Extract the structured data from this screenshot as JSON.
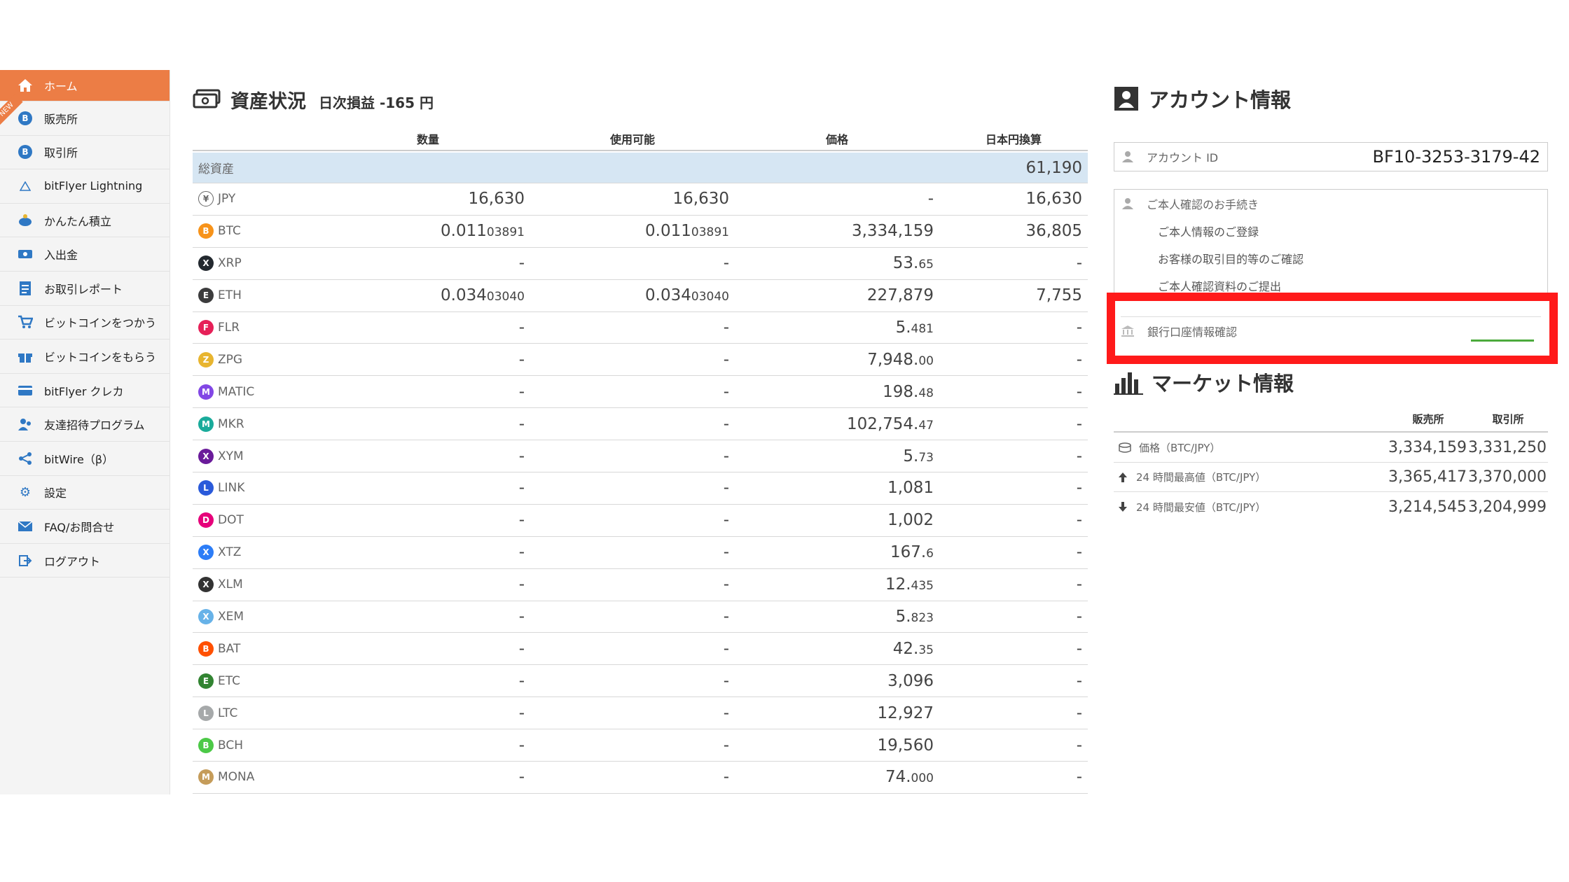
{
  "sidebar": {
    "new_badge": "NEW",
    "items": [
      {
        "label": "ホーム",
        "icon": "home-icon"
      },
      {
        "label": "販売所",
        "icon": "bitcoin-circle-icon"
      },
      {
        "label": "取引所",
        "icon": "bitcoin-circle-icon"
      },
      {
        "label": "bitFlyer Lightning",
        "icon": "lightning-triangle-icon"
      },
      {
        "label": "かんたん積立",
        "icon": "piggy-bank-icon"
      },
      {
        "label": "入出金",
        "icon": "money-icon"
      },
      {
        "label": "お取引レポート",
        "icon": "report-icon"
      },
      {
        "label": "ビットコインをつかう",
        "icon": "cart-icon"
      },
      {
        "label": "ビットコインをもらう",
        "icon": "gift-icon"
      },
      {
        "label": "bitFlyer クレカ",
        "icon": "credit-card-icon"
      },
      {
        "label": "友達招待プログラム",
        "icon": "users-icon"
      },
      {
        "label": "bitWire（β）",
        "icon": "share-icon"
      },
      {
        "label": "設定",
        "icon": "gear-icon"
      },
      {
        "label": "FAQ/お問合せ",
        "icon": "mail-icon"
      },
      {
        "label": "ログアウト",
        "icon": "logout-icon"
      }
    ]
  },
  "assets": {
    "title": "資産状況",
    "daily_pl": "日次損益 -165 円",
    "headers": {
      "qty": "数量",
      "available": "使用可能",
      "price": "価格",
      "jpy": "日本円換算"
    },
    "total_label": "総資産",
    "total_value": "61,190",
    "rows": [
      {
        "sym": "JPY",
        "color": "#ffffff",
        "qty_main": "16,630",
        "qty_small": "",
        "avail_main": "16,630",
        "avail_small": "",
        "price_main": "-",
        "price_small": "",
        "jpy": "16,630"
      },
      {
        "sym": "BTC",
        "color": "#f7931a",
        "qty_main": "0.011",
        "qty_small": "03891",
        "avail_main": "0.011",
        "avail_small": "03891",
        "price_main": "3,334,159",
        "price_small": "",
        "jpy": "36,805"
      },
      {
        "sym": "XRP",
        "color": "#23292f",
        "qty_main": "-",
        "qty_small": "",
        "avail_main": "-",
        "avail_small": "",
        "price_main": "53.",
        "price_small": "65",
        "jpy": "-"
      },
      {
        "sym": "ETH",
        "color": "#3c3c3d",
        "qty_main": "0.034",
        "qty_small": "03040",
        "avail_main": "0.034",
        "avail_small": "03040",
        "price_main": "227,879",
        "price_small": "",
        "jpy": "7,755"
      },
      {
        "sym": "FLR",
        "color": "#e62058",
        "qty_main": "-",
        "qty_small": "",
        "avail_main": "-",
        "avail_small": "",
        "price_main": "5.",
        "price_small": "481",
        "jpy": "-"
      },
      {
        "sym": "ZPG",
        "color": "#e8b52f",
        "qty_main": "-",
        "qty_small": "",
        "avail_main": "-",
        "avail_small": "",
        "price_main": "7,948.",
        "price_small": "00",
        "jpy": "-"
      },
      {
        "sym": "MATIC",
        "color": "#8247e5",
        "qty_main": "-",
        "qty_small": "",
        "avail_main": "-",
        "avail_small": "",
        "price_main": "198.",
        "price_small": "48",
        "jpy": "-"
      },
      {
        "sym": "MKR",
        "color": "#1aab9b",
        "qty_main": "-",
        "qty_small": "",
        "avail_main": "-",
        "avail_small": "",
        "price_main": "102,754.",
        "price_small": "47",
        "jpy": "-"
      },
      {
        "sym": "XYM",
        "color": "#6a1b9a",
        "qty_main": "-",
        "qty_small": "",
        "avail_main": "-",
        "avail_small": "",
        "price_main": "5.",
        "price_small": "73",
        "jpy": "-"
      },
      {
        "sym": "LINK",
        "color": "#2a5ada",
        "qty_main": "-",
        "qty_small": "",
        "avail_main": "-",
        "avail_small": "",
        "price_main": "1,081",
        "price_small": "",
        "jpy": "-"
      },
      {
        "sym": "DOT",
        "color": "#e6007a",
        "qty_main": "-",
        "qty_small": "",
        "avail_main": "-",
        "avail_small": "",
        "price_main": "1,002",
        "price_small": "",
        "jpy": "-"
      },
      {
        "sym": "XTZ",
        "color": "#2c7df7",
        "qty_main": "-",
        "qty_small": "",
        "avail_main": "-",
        "avail_small": "",
        "price_main": "167.",
        "price_small": "6",
        "jpy": "-"
      },
      {
        "sym": "XLM",
        "color": "#333333",
        "qty_main": "-",
        "qty_small": "",
        "avail_main": "-",
        "avail_small": "",
        "price_main": "12.",
        "price_small": "435",
        "jpy": "-"
      },
      {
        "sym": "XEM",
        "color": "#67b2e8",
        "qty_main": "-",
        "qty_small": "",
        "avail_main": "-",
        "avail_small": "",
        "price_main": "5.",
        "price_small": "823",
        "jpy": "-"
      },
      {
        "sym": "BAT",
        "color": "#ff5000",
        "qty_main": "-",
        "qty_small": "",
        "avail_main": "-",
        "avail_small": "",
        "price_main": "42.",
        "price_small": "35",
        "jpy": "-"
      },
      {
        "sym": "ETC",
        "color": "#328432",
        "qty_main": "-",
        "qty_small": "",
        "avail_main": "-",
        "avail_small": "",
        "price_main": "3,096",
        "price_small": "",
        "jpy": "-"
      },
      {
        "sym": "LTC",
        "color": "#a6a9aa",
        "qty_main": "-",
        "qty_small": "",
        "avail_main": "-",
        "avail_small": "",
        "price_main": "12,927",
        "price_small": "",
        "jpy": "-"
      },
      {
        "sym": "BCH",
        "color": "#4cc947",
        "qty_main": "-",
        "qty_small": "",
        "avail_main": "-",
        "avail_small": "",
        "price_main": "19,560",
        "price_small": "",
        "jpy": "-"
      },
      {
        "sym": "MONA",
        "color": "#c59c5a",
        "qty_main": "-",
        "qty_small": "",
        "avail_main": "-",
        "avail_small": "",
        "price_main": "74.",
        "price_small": "000",
        "jpy": "-"
      }
    ]
  },
  "account": {
    "title": "アカウント情報",
    "id_label": "アカウント ID",
    "id_value": "BF10-3253-3179-42",
    "kyc_head": "ご本人確認のお手続き",
    "kyc_items": [
      "ご本人情報のご登録",
      "お客様の取引目的等のご確認",
      "ご本人確認資料のご提出"
    ],
    "bank_label": "銀行口座情報確認"
  },
  "market": {
    "title": "マーケット情報",
    "col_sales": "販売所",
    "col_exchange": "取引所",
    "rows": [
      {
        "label": "価格（BTC/JPY）",
        "icon": "coins-icon",
        "sales": "3,334,159",
        "exchange": "3,331,250"
      },
      {
        "label": "24 時間最高値（BTC/JPY）",
        "icon": "arrow-up-icon",
        "sales": "3,365,417",
        "exchange": "3,370,000"
      },
      {
        "label": "24 時間最安値（BTC/JPY）",
        "icon": "arrow-down-icon",
        "sales": "3,214,545",
        "exchange": "3,204,999"
      }
    ]
  }
}
